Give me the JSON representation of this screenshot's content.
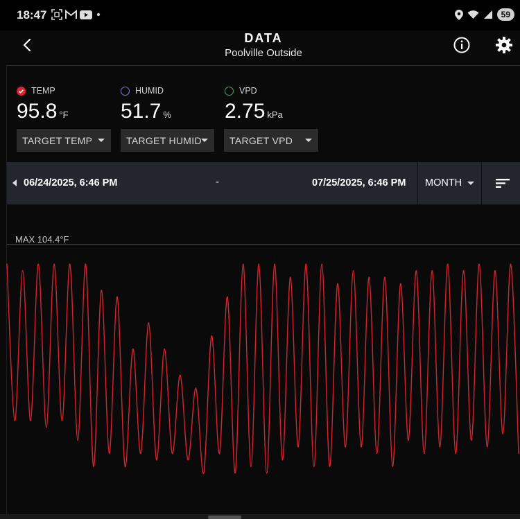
{
  "status_bar": {
    "time": "18:47",
    "battery": "59",
    "left_icons": [
      "screenshot-icon",
      "gmail-icon",
      "youtube-icon",
      "dot-icon"
    ],
    "right_icons": [
      "location-icon",
      "wifi-icon",
      "signal-icon"
    ]
  },
  "header": {
    "title": "DATA",
    "subtitle": "Poolville Outside"
  },
  "metrics": [
    {
      "label": "TEMP",
      "value": "95.8",
      "unit": "°F",
      "selected": true,
      "color": "#e0202e"
    },
    {
      "label": "HUMID",
      "value": "51.7",
      "unit": "%",
      "selected": false,
      "color": "#7a78e6"
    },
    {
      "label": "VPD",
      "value": "2.75",
      "unit": "kPa",
      "selected": false,
      "color": "#3aa86a"
    }
  ],
  "targets": {
    "temp": "TARGET TEMP",
    "humid": "TARGET HUMID",
    "vpd": "TARGET VPD"
  },
  "range": {
    "start": "06/24/2025, 6:46 PM",
    "separator": "-",
    "end": "07/25/2025, 6:46 PM",
    "period": "MONTH"
  },
  "chart": {
    "max_label": "MAX 104.4°F",
    "line_color": "#d4232c"
  },
  "chart_data": {
    "type": "line",
    "series": [
      {
        "values": [
          104,
          80,
          103,
          80,
          104,
          79,
          104,
          80,
          104,
          77,
          104,
          73,
          100,
          75,
          99,
          73,
          91,
          75,
          95,
          74,
          91,
          75,
          87,
          74,
          85,
          72,
          93,
          75,
          99,
          72,
          104,
          73,
          104,
          72,
          104,
          74,
          102,
          76,
          104,
          73,
          104,
          73,
          101,
          76,
          103,
          76,
          102,
          75,
          102,
          73,
          101,
          77,
          103,
          75,
          103,
          76,
          104,
          75,
          103,
          77,
          104,
          76,
          103,
          78,
          104,
          75
        ]
      }
    ],
    "ylim": [
      66,
      107
    ],
    "xlabel": "",
    "ylabel": ""
  }
}
